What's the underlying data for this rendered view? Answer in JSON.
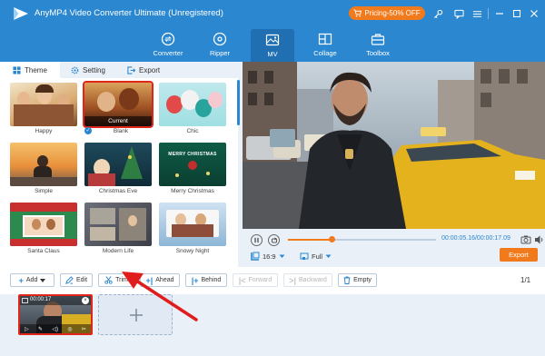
{
  "app": {
    "title": "AnyMP4 Video Converter Ultimate (Unregistered)",
    "pricing_label": "Pricing-50% OFF"
  },
  "nav": {
    "items": [
      {
        "label": "Converter",
        "icon": "converter-icon"
      },
      {
        "label": "Ripper",
        "icon": "ripper-icon"
      },
      {
        "label": "MV",
        "icon": "mv-icon",
        "active": true
      },
      {
        "label": "Collage",
        "icon": "collage-icon"
      },
      {
        "label": "Toolbox",
        "icon": "toolbox-icon"
      }
    ]
  },
  "panel": {
    "tabs": [
      {
        "label": "Theme",
        "icon": "theme-icon",
        "active": true
      },
      {
        "label": "Setting",
        "icon": "gear-icon"
      },
      {
        "label": "Export",
        "icon": "export-icon"
      }
    ],
    "themes": [
      {
        "label": "Happy"
      },
      {
        "label": "Blank",
        "overlay": "Current",
        "selected": true
      },
      {
        "label": "Chic"
      },
      {
        "label": "Simple"
      },
      {
        "label": "Christmas Eve"
      },
      {
        "label": "Merry Christmas",
        "overlay": "MERRY CHRISTMAS"
      },
      {
        "label": "Santa Claus"
      },
      {
        "label": "Modern Life"
      },
      {
        "label": "Snowy Night"
      }
    ]
  },
  "player": {
    "time": "00:00:05.16/00:00:17.09",
    "progress": 0.3,
    "aspect": "16:9",
    "zoom": "Full",
    "export_label": "Export"
  },
  "toolbar": {
    "add": "Add",
    "edit": "Edit",
    "trim": "Trim",
    "ahead": "Ahead",
    "behind": "Behind",
    "forward": "Forward",
    "backward": "Backward",
    "empty": "Empty",
    "page": "1/1"
  },
  "timeline": {
    "clip_duration": "00:00:17"
  },
  "colors": {
    "brand": "#2a87d0",
    "accent": "#f17a1c",
    "selection": "#e1251b"
  }
}
